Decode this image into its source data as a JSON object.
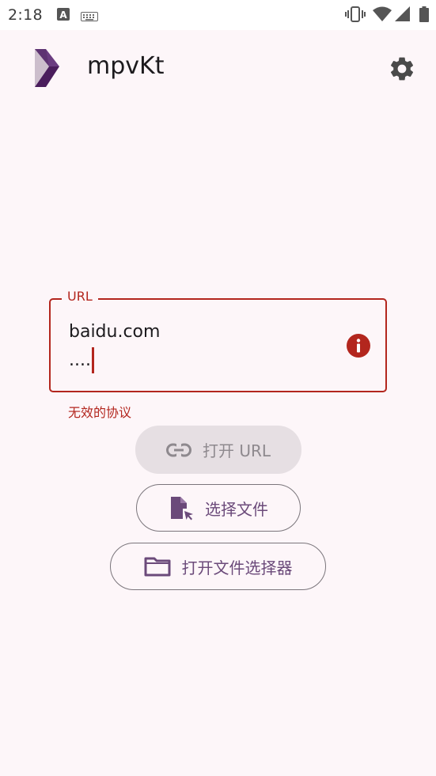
{
  "status_bar": {
    "time": "2:18",
    "icons": [
      "text-a-notification-icon",
      "keyboard-icon",
      "vibrate-icon",
      "wifi-icon",
      "cell-signal-icon",
      "battery-icon"
    ]
  },
  "app_bar": {
    "title": "mpvKt",
    "logo": "mpvkt-logo",
    "settings_icon": "gear-icon"
  },
  "url_field": {
    "label": "URL",
    "value": "baidu.com\n....",
    "error_icon": "error-info-icon",
    "error_text": "无效的协议"
  },
  "buttons": {
    "open_url": {
      "label": "打开 URL",
      "icon": "link-icon",
      "enabled": false
    },
    "choose_file": {
      "label": "选择文件",
      "icon": "file-select-icon"
    },
    "file_picker": {
      "label": "打开文件选择器",
      "icon": "folder-icon"
    }
  },
  "colors": {
    "background": "#fdf6f9",
    "error": "#b3261e",
    "accent": "#6b4a7a",
    "disabled_bg": "#e6dfe3",
    "outline": "#7a757b"
  }
}
